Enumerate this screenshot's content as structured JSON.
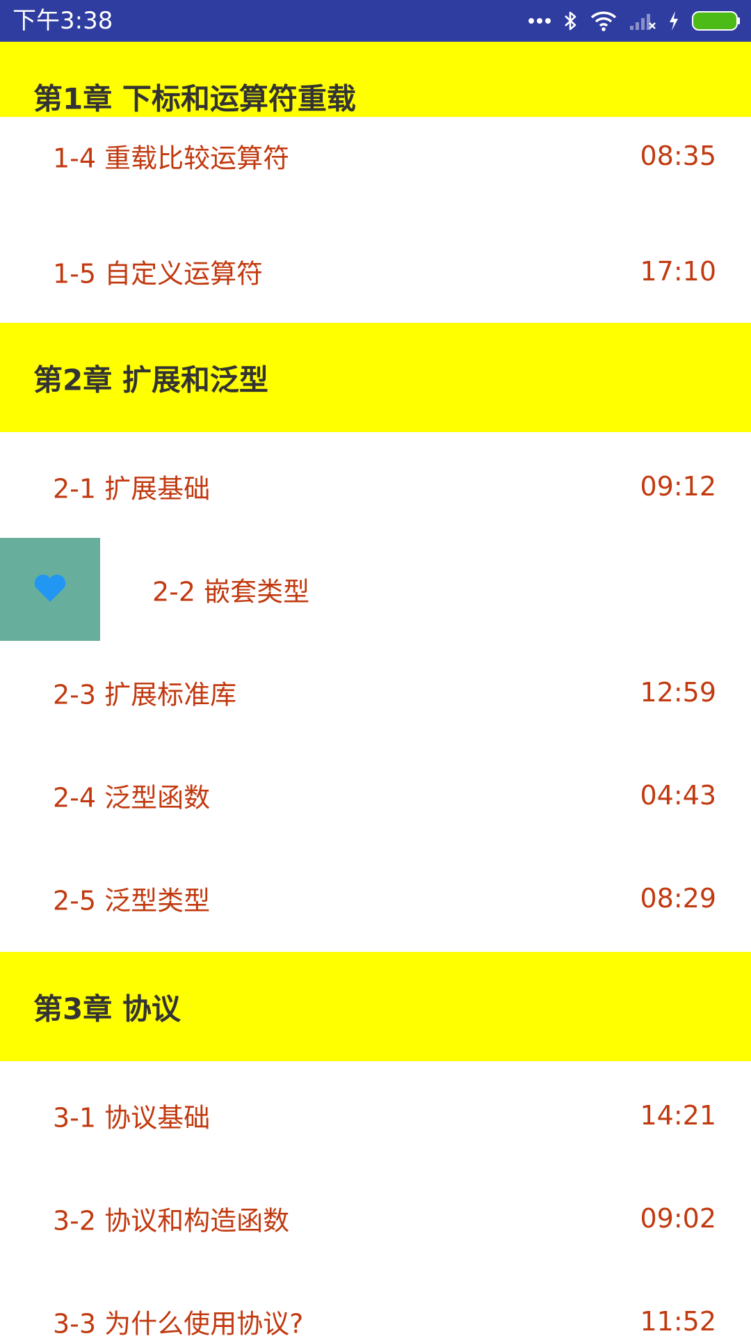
{
  "status_bar": {
    "time": "下午3:38",
    "icons": [
      "more-dots-icon",
      "bluetooth-icon",
      "wifi-icon",
      "signal-icon",
      "charging-icon",
      "battery-icon"
    ]
  },
  "colors": {
    "status_bar_bg": "#2f3ca0",
    "chapter_bg": "#ffff00",
    "chapter_text": "#333333",
    "lesson_text": "#c1390f",
    "swipe_action_bg": "#67ae9c",
    "heart": "#2196f3",
    "battery_fill": "#4cbb17"
  },
  "sections": [
    {
      "title": "第1章 下标和运算符重载",
      "lessons": [
        {
          "name": "1-4 重载比较运算符",
          "duration": "08:35"
        },
        {
          "name": "1-5 自定义运算符",
          "duration": "17:10"
        }
      ]
    },
    {
      "title": "第2章 扩展和泛型",
      "lessons": [
        {
          "name": "2-1 扩展基础",
          "duration": "09:12"
        },
        {
          "name": "2-2 嵌套类型",
          "duration": ""
        },
        {
          "name": "2-3 扩展标准库",
          "duration": "12:59"
        },
        {
          "name": "2-4 泛型函数",
          "duration": "04:43"
        },
        {
          "name": "2-5 泛型类型",
          "duration": "08:29"
        }
      ]
    },
    {
      "title": "第3章 协议",
      "lessons": [
        {
          "name": "3-1 协议基础",
          "duration": "14:21"
        },
        {
          "name": "3-2 协议和构造函数",
          "duration": "09:02"
        },
        {
          "name": "3-3 为什么使用协议?",
          "duration": "11:52"
        }
      ]
    }
  ],
  "swiped_row": {
    "action_icon": "heart-icon"
  }
}
